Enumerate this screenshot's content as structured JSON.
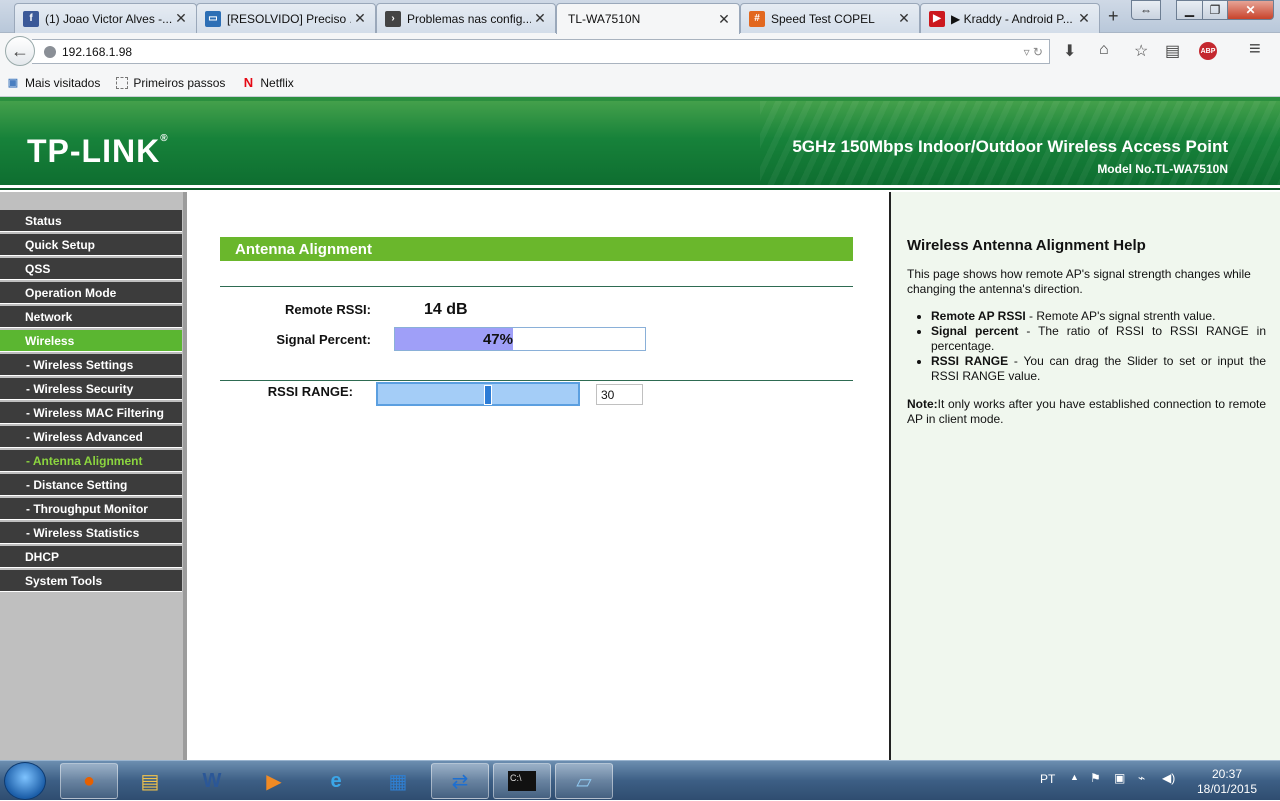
{
  "browser": {
    "tabs": [
      {
        "label": "(1) Joao Victor Alves -...",
        "icon": "facebook-icon",
        "color": "#3b5998"
      },
      {
        "label": "[RESOLVIDO] Preciso ...",
        "icon": "forum-icon",
        "color": "#2d6fb5"
      },
      {
        "label": "Problemas nas config...",
        "icon": "arrow-site-icon",
        "color": "#444444"
      },
      {
        "label": "TL-WA7510N",
        "icon": "",
        "color": ""
      },
      {
        "label": "Speed Test COPEL",
        "icon": "copel-icon",
        "color": "#e2681f"
      },
      {
        "label": "▶ Kraddy - Android P...",
        "icon": "youtube-icon",
        "color": "#cc181e"
      }
    ],
    "url": "192.168.1.98",
    "bookmarks": [
      {
        "label": "Mais visitados",
        "icon": "bookmark-icon"
      },
      {
        "label": "Primeiros passos",
        "icon": "page-icon"
      },
      {
        "label": "Netflix",
        "icon": "netflix-icon"
      }
    ]
  },
  "header": {
    "logo": "TP-LINK",
    "logo_mark": "®",
    "product": "5GHz 150Mbps Indoor/Outdoor Wireless Access Point",
    "model": "Model No.TL-WA7510N"
  },
  "menu": [
    {
      "label": "Status",
      "sub": false,
      "active": false,
      "current": false
    },
    {
      "label": "Quick Setup",
      "sub": false,
      "active": false,
      "current": false
    },
    {
      "label": "QSS",
      "sub": false,
      "active": false,
      "current": false
    },
    {
      "label": "Operation Mode",
      "sub": false,
      "active": false,
      "current": false
    },
    {
      "label": "Network",
      "sub": false,
      "active": false,
      "current": false
    },
    {
      "label": "Wireless",
      "sub": false,
      "active": true,
      "current": false
    },
    {
      "label": "- Wireless Settings",
      "sub": true,
      "active": false,
      "current": false
    },
    {
      "label": "- Wireless Security",
      "sub": true,
      "active": false,
      "current": false
    },
    {
      "label": "- Wireless MAC Filtering",
      "sub": true,
      "active": false,
      "current": false
    },
    {
      "label": "- Wireless Advanced",
      "sub": true,
      "active": false,
      "current": false
    },
    {
      "label": "- Antenna Alignment",
      "sub": true,
      "active": false,
      "current": true
    },
    {
      "label": "- Distance Setting",
      "sub": true,
      "active": false,
      "current": false
    },
    {
      "label": "- Throughput Monitor",
      "sub": true,
      "active": false,
      "current": false
    },
    {
      "label": "- Wireless Statistics",
      "sub": true,
      "active": false,
      "current": false
    },
    {
      "label": "DHCP",
      "sub": false,
      "active": false,
      "current": false
    },
    {
      "label": "System Tools",
      "sub": false,
      "active": false,
      "current": false
    }
  ],
  "main": {
    "title": "Antenna Alignment",
    "remote_rssi_label": "Remote RSSI:",
    "remote_rssi_value": "14 dB",
    "signal_percent_label": "Signal Percent:",
    "signal_percent_text": "47%",
    "signal_percent": 0.47,
    "rssi_range_label": "RSSI RANGE:",
    "rssi_range_value": "30"
  },
  "help": {
    "title": "Wireless Antenna Alignment Help",
    "intro": "This page shows how remote AP's signal strength changes while changing the antenna's direction.",
    "items": [
      {
        "term": "Remote AP RSSI",
        "text": " - Remote AP's signal strenth value."
      },
      {
        "term": "Signal percent",
        "text": " - The ratio of RSSI to RSSI RANGE in percentage."
      },
      {
        "term": "RSSI RANGE",
        "text": " - You can drag the Slider to set or input the RSSI RANGE value."
      }
    ],
    "note_term": "Note:",
    "note_text": "It only works after you have established connection to remote AP in client mode."
  },
  "taskbar": {
    "apps": [
      "firefox-icon",
      "explorer-icon",
      "word-icon",
      "media-player-icon",
      "ie-icon",
      "network-icon",
      "teamviewer-icon",
      "cmd-icon",
      "notepad-icon"
    ],
    "language": "PT",
    "time": "20:37",
    "date": "18/01/2015"
  }
}
